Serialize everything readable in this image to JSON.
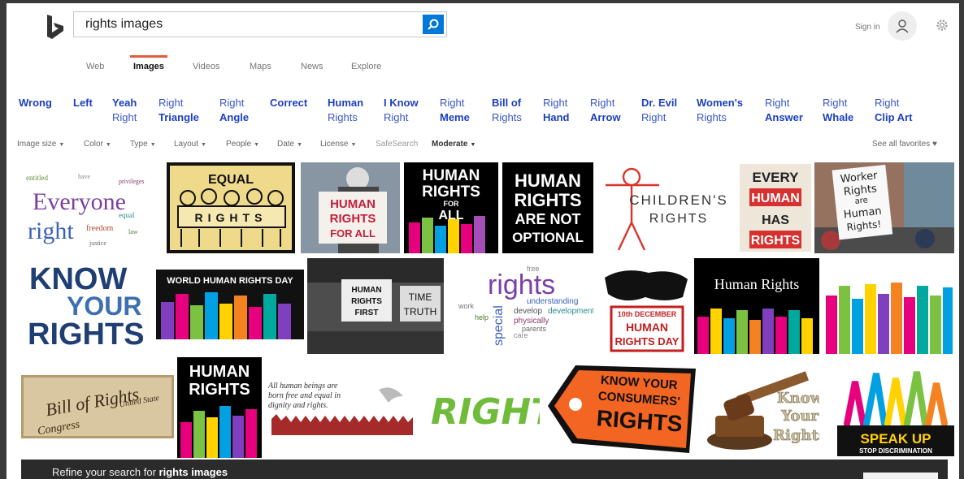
{
  "search": {
    "query": "rights images"
  },
  "account": {
    "sign_in": "Sign in"
  },
  "tabs": [
    {
      "label": "Web"
    },
    {
      "label": "Images",
      "active": true
    },
    {
      "label": "Videos"
    },
    {
      "label": "Maps"
    },
    {
      "label": "News"
    },
    {
      "label": "Explore"
    }
  ],
  "related": [
    {
      "a": "Wrong",
      "b": ""
    },
    {
      "a": "Left",
      "b": ""
    },
    {
      "a": "Yeah",
      "b": "Right"
    },
    {
      "a": "Right",
      "b": "Triangle"
    },
    {
      "a": "Right",
      "b": "Angle"
    },
    {
      "a": "Correct",
      "b": ""
    },
    {
      "a": "Human",
      "b": "Rights"
    },
    {
      "a": "I Know",
      "b": "Right"
    },
    {
      "a": "Right",
      "b": "Meme"
    },
    {
      "a": "Bill of",
      "b": "Rights"
    },
    {
      "a": "Right",
      "b": "Hand"
    },
    {
      "a": "Right",
      "b": "Arrow"
    },
    {
      "a": "Dr. Evil",
      "b": "Right"
    },
    {
      "a": "Women's",
      "b": "Rights"
    },
    {
      "a": "Right",
      "b": "Answer"
    },
    {
      "a": "Right",
      "b": "Whale"
    },
    {
      "a": "Right",
      "b": "Clip Art"
    }
  ],
  "filters": {
    "image_size": "Image size",
    "color": "Color",
    "type": "Type",
    "layout": "Layout",
    "people": "People",
    "date": "Date",
    "license": "License",
    "safesearch": "SafeSearch",
    "moderate": "Moderate",
    "favorites": "See all favorites"
  },
  "images": {
    "everyone": {
      "l1": "Everyone",
      "l2": "right"
    },
    "equal": {
      "l1": "EQUAL",
      "l2": "RIGHTS"
    },
    "protest_sign": {
      "l1": "HUMAN",
      "l2": "RIGHTS",
      "l3": "FOR ALL"
    },
    "hr_all": {
      "l1": "HUMAN",
      "l2": "RIGHTS",
      "l3": "FOR",
      "l4": "ALL"
    },
    "not_optional": {
      "l1": "HUMAN",
      "l2": "RIGHTS",
      "l3": "ARE NOT",
      "l4": "OPTIONAL"
    },
    "childrens": {
      "l1": "CHILDREN'S",
      "l2": "RIGHTS"
    },
    "every_human": {
      "l1": "EVERY",
      "l2": "HUMAN",
      "l3": "HAS",
      "l4": "RIGHTS"
    },
    "worker": {
      "l1": "Worker",
      "l2": "Rights",
      "l3": "are",
      "l4": "Human",
      "l5": "Rights!"
    },
    "know_your": {
      "l1": "KNOW",
      "l2": "YOUR",
      "l3": "RIGHTS"
    },
    "world_day": {
      "l1": "WORLD HUMAN RIGHTS DAY"
    },
    "bw_protest": {
      "l1": "HUMAN",
      "l2": "RIGHTS",
      "l3": "FIRST",
      "l4": "TIME",
      "l5": "TRUTH"
    },
    "wordcloud": {
      "l1": "rights",
      "l2": "free",
      "l3": "understanding",
      "l4": "develop",
      "l5": "development",
      "l6": "physically",
      "l7": "special",
      "l8": "work",
      "l9": "help",
      "l10": "care",
      "l11": "parents"
    },
    "december": {
      "l1": "10th DECEMBER",
      "l2": "HUMAN",
      "l3": "RIGHTS DAY"
    },
    "hr_black": {
      "l1": "Human Rights"
    },
    "bill": {
      "l1": "Bill of Rights",
      "l2": "United State",
      "l3": "Congress"
    },
    "hr_hands": {
      "l1": "HUMAN",
      "l2": "RIGHTS"
    },
    "all_born": {
      "l1": "All human beings are",
      "l2": "born free and equal in",
      "l3": "dignity and rights."
    },
    "right_bang": {
      "l1": "RIGHT!"
    },
    "consumers": {
      "l1": "KNOW YOUR",
      "l2": "CONSUMERS'",
      "l3": "RIGHTS"
    },
    "gavel": {
      "l1": "Know",
      "l2": "Your",
      "l3": "Rights"
    },
    "speak_up": {
      "l1": "SPEAK UP",
      "l2": "STOP DISCRIMINATION"
    }
  },
  "refine": {
    "prefix": "Refine your search for",
    "query": "rights images"
  },
  "colors": {
    "accent": "#0078d7",
    "tab_underline": "#e55b3c",
    "link": "#1c3fbf"
  }
}
